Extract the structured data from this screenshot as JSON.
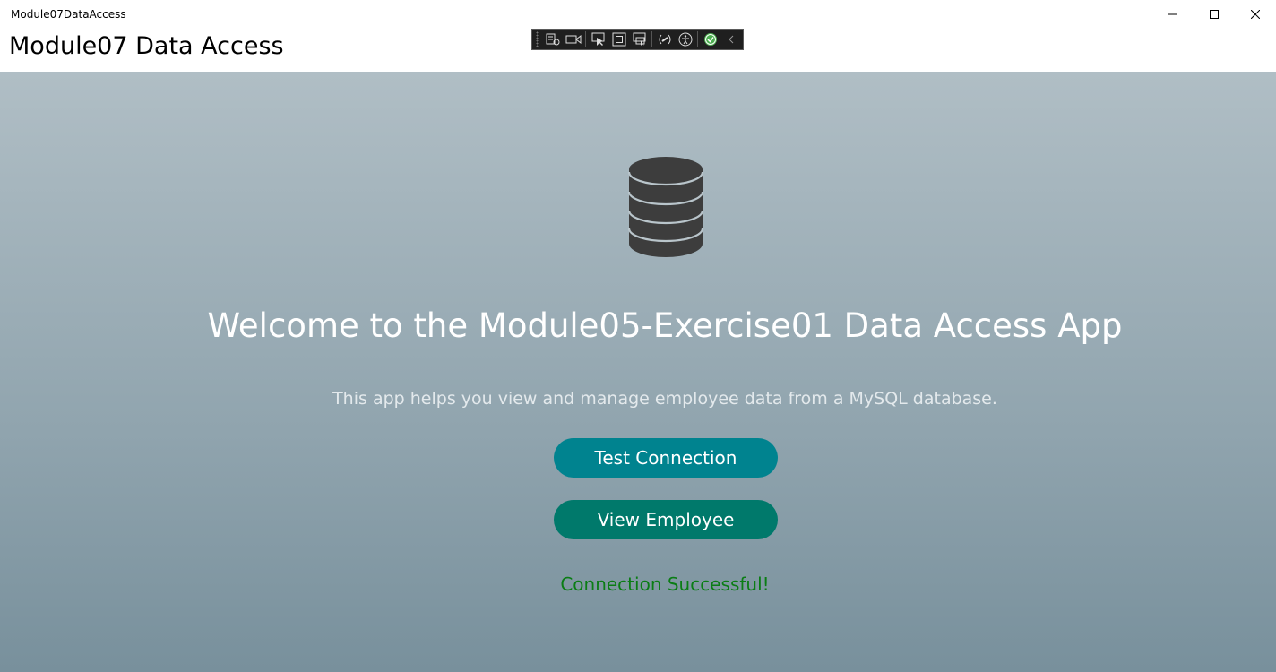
{
  "window": {
    "title": "Module07DataAccess",
    "controls": {
      "minimize_icon": "minimize-icon",
      "maximize_icon": "maximize-icon",
      "close_icon": "close-icon"
    }
  },
  "header": {
    "title": "Module07 Data Access"
  },
  "debug_toolbar": {
    "icons": [
      "live-visual-tree-icon",
      "video-icon",
      "select-element-icon",
      "display-adorners-icon",
      "track-focus-icon",
      "binding-failures-icon",
      "accessibility-icon",
      "hot-reload-status-icon",
      "collapse-chevron-icon"
    ]
  },
  "main": {
    "hero_icon": "database-icon",
    "welcome_title": "Welcome to the Module05-Exercise01 Data Access App",
    "subtitle": "This app helps you view and manage employee data from a MySQL database.",
    "buttons": {
      "test_connection": "Test Connection",
      "view_employee": "View Employee"
    },
    "status": "Connection Successful!"
  },
  "colors": {
    "test_button": "#00838f",
    "view_button": "#00796b",
    "status_success": "#0a7d14",
    "db_icon": "#3d3d3d"
  }
}
